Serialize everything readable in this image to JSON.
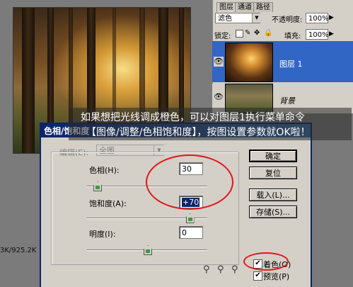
{
  "document": {
    "status_text": "3K/925.2K"
  },
  "layers_panel": {
    "tabs": [
      "图层",
      "通道",
      "路径"
    ],
    "blend_mode": "滤色",
    "opacity_label": "不透明度:",
    "opacity_value": "100%",
    "lock_label": "锁定:",
    "fill_label": "填充:",
    "fill_value": "100%",
    "layers": [
      {
        "name": "图层 1",
        "selected": true,
        "visible": true
      },
      {
        "name": "背景",
        "selected": false,
        "visible": true
      }
    ]
  },
  "caption": {
    "line1": "如果想把光线调成橙色，可以对图层1执行菜单命令",
    "line2": "【图像/调整/色相饱和度】，按图设置参数就OK啦！"
  },
  "dialog": {
    "title": "色相/饱和度",
    "edit_label": "编辑(E):",
    "edit_value": "全图",
    "hue_label": "色相(H):",
    "hue_value": "30",
    "hue_level": 0.083,
    "saturation_label": "饱和度(A):",
    "saturation_value": "+70",
    "saturation_level": 0.85,
    "lightness_label": "明度(I):",
    "lightness_value": "0",
    "lightness_level": 0.5,
    "buttons": {
      "ok": "确定",
      "reset": "复位",
      "load": "载入(L)...",
      "save": "存储(S)..."
    },
    "colorize_label": "着色(O)",
    "colorize_checked": true,
    "preview_label": "预览(P)",
    "preview_checked": true
  },
  "colors": {
    "annotation_red": "#e0161a",
    "title_bar_blue": "#0a246a",
    "selected_layer_blue": "#3166c5"
  }
}
